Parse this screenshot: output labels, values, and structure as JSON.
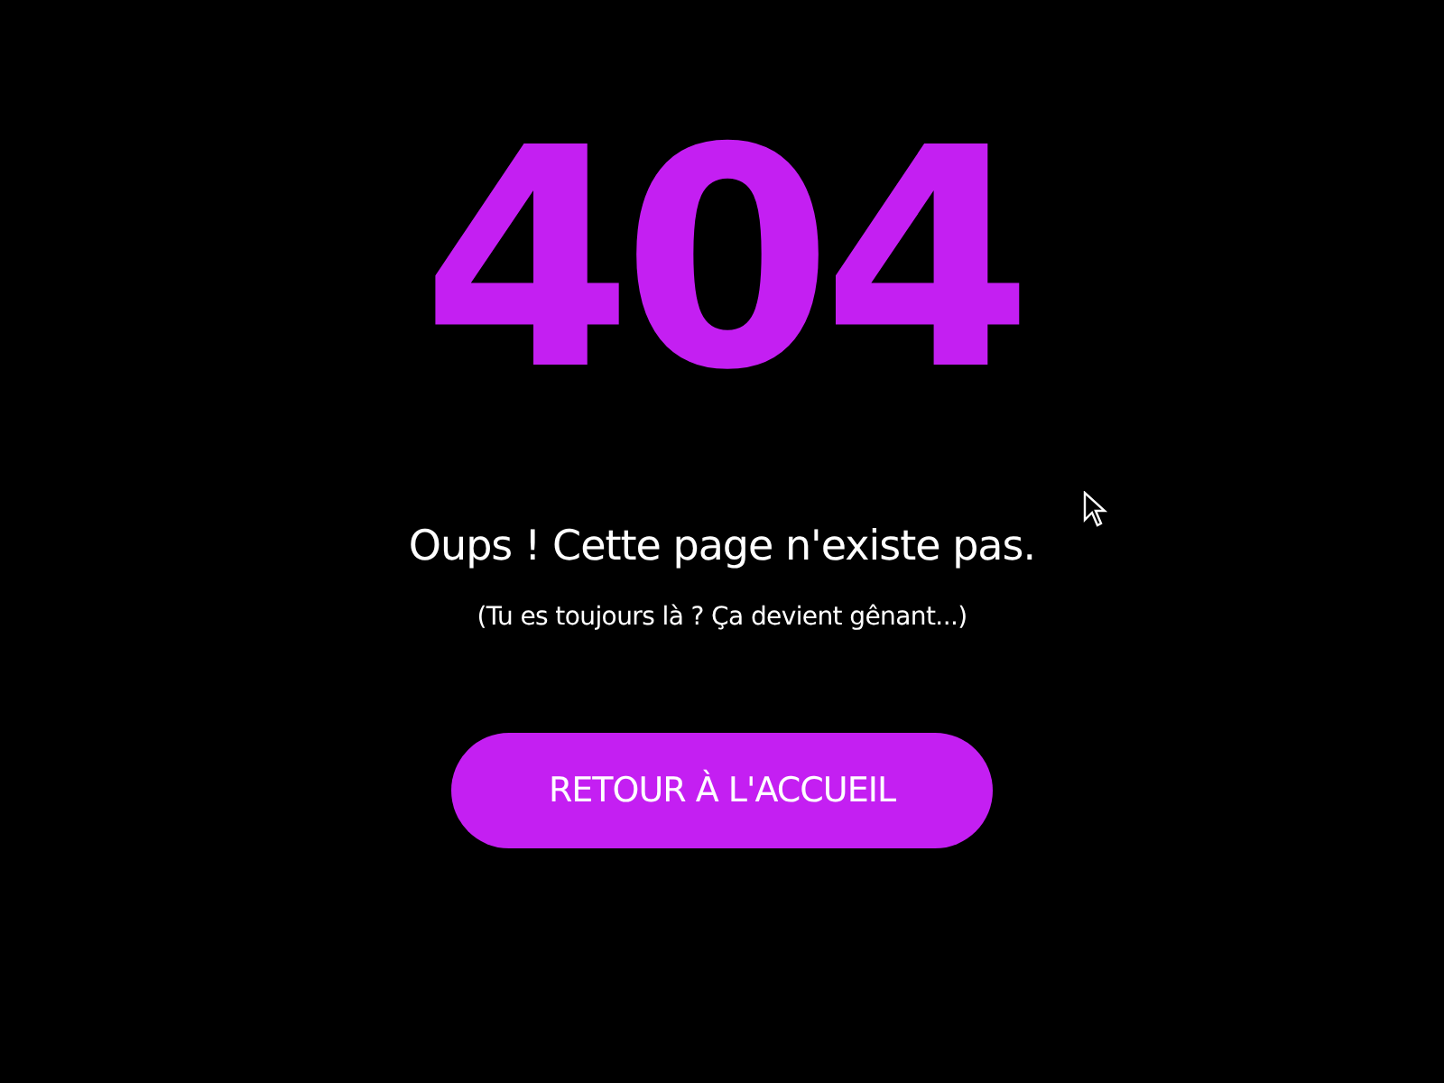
{
  "error_code": "404",
  "title": "Oups ! Cette page n'existe pas.",
  "subtitle": "(Tu es toujours là ? Ça devient gênant...)",
  "button": {
    "label": "RETOUR À L'ACCUEIL"
  }
}
